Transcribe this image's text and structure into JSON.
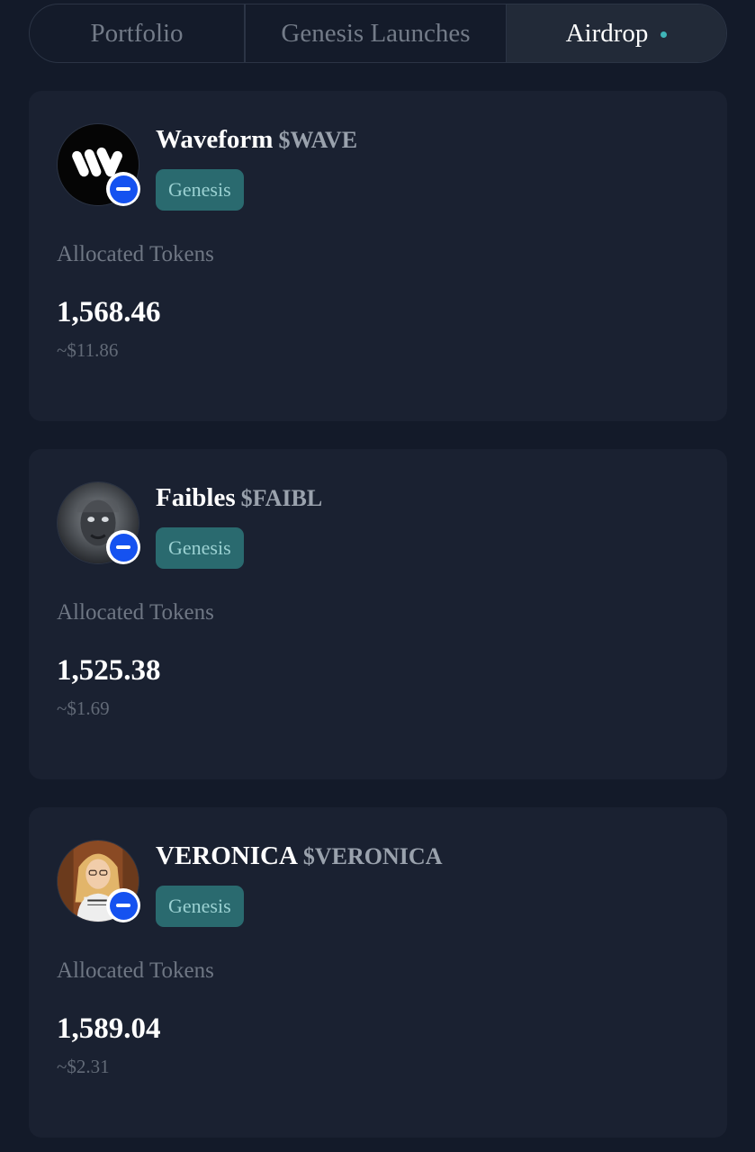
{
  "tabs": [
    {
      "label": "Portfolio"
    },
    {
      "label": "Genesis Launches"
    },
    {
      "label": "Airdrop",
      "active": true
    }
  ],
  "colors": {
    "background": "#131a29",
    "card": "#1a2131",
    "tag_bg": "#2a6a6f",
    "tag_text": "#9bd1d2",
    "accent_dot": "#3fb5b8",
    "chain_blue": "#1552f0"
  },
  "cards": [
    {
      "name": "Waveform",
      "ticker": "$WAVE",
      "tag": "Genesis",
      "alloc_label": "Allocated Tokens",
      "amount": "1,568.46",
      "usd": "~$11.86",
      "avatar_icon": "waveform-logo-icon",
      "chain_icon": "base-chain-icon"
    },
    {
      "name": "Faibles",
      "ticker": "$FAIBL",
      "tag": "Genesis",
      "alloc_label": "Allocated Tokens",
      "amount": "1,525.38",
      "usd": "~$1.69",
      "avatar_icon": "faibles-avatar-icon",
      "chain_icon": "base-chain-icon"
    },
    {
      "name": "VERONICA",
      "ticker": "$VERONICA",
      "tag": "Genesis",
      "alloc_label": "Allocated Tokens",
      "amount": "1,589.04",
      "usd": "~$2.31",
      "avatar_icon": "veronica-avatar-icon",
      "chain_icon": "base-chain-icon"
    }
  ]
}
